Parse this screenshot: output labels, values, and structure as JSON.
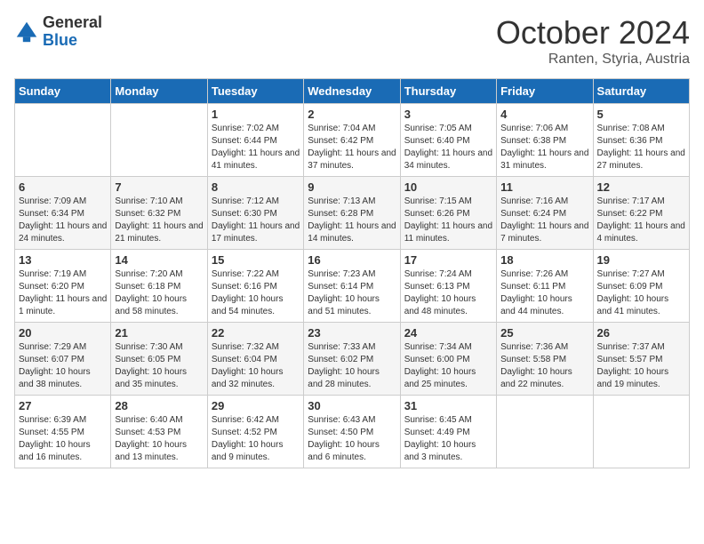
{
  "header": {
    "logo_general": "General",
    "logo_blue": "Blue",
    "month": "October 2024",
    "location": "Ranten, Styria, Austria"
  },
  "days_of_week": [
    "Sunday",
    "Monday",
    "Tuesday",
    "Wednesday",
    "Thursday",
    "Friday",
    "Saturday"
  ],
  "weeks": [
    [
      {
        "day": "",
        "content": ""
      },
      {
        "day": "",
        "content": ""
      },
      {
        "day": "1",
        "content": "Sunrise: 7:02 AM\nSunset: 6:44 PM\nDaylight: 11 hours and 41 minutes."
      },
      {
        "day": "2",
        "content": "Sunrise: 7:04 AM\nSunset: 6:42 PM\nDaylight: 11 hours and 37 minutes."
      },
      {
        "day": "3",
        "content": "Sunrise: 7:05 AM\nSunset: 6:40 PM\nDaylight: 11 hours and 34 minutes."
      },
      {
        "day": "4",
        "content": "Sunrise: 7:06 AM\nSunset: 6:38 PM\nDaylight: 11 hours and 31 minutes."
      },
      {
        "day": "5",
        "content": "Sunrise: 7:08 AM\nSunset: 6:36 PM\nDaylight: 11 hours and 27 minutes."
      }
    ],
    [
      {
        "day": "6",
        "content": "Sunrise: 7:09 AM\nSunset: 6:34 PM\nDaylight: 11 hours and 24 minutes."
      },
      {
        "day": "7",
        "content": "Sunrise: 7:10 AM\nSunset: 6:32 PM\nDaylight: 11 hours and 21 minutes."
      },
      {
        "day": "8",
        "content": "Sunrise: 7:12 AM\nSunset: 6:30 PM\nDaylight: 11 hours and 17 minutes."
      },
      {
        "day": "9",
        "content": "Sunrise: 7:13 AM\nSunset: 6:28 PM\nDaylight: 11 hours and 14 minutes."
      },
      {
        "day": "10",
        "content": "Sunrise: 7:15 AM\nSunset: 6:26 PM\nDaylight: 11 hours and 11 minutes."
      },
      {
        "day": "11",
        "content": "Sunrise: 7:16 AM\nSunset: 6:24 PM\nDaylight: 11 hours and 7 minutes."
      },
      {
        "day": "12",
        "content": "Sunrise: 7:17 AM\nSunset: 6:22 PM\nDaylight: 11 hours and 4 minutes."
      }
    ],
    [
      {
        "day": "13",
        "content": "Sunrise: 7:19 AM\nSunset: 6:20 PM\nDaylight: 11 hours and 1 minute."
      },
      {
        "day": "14",
        "content": "Sunrise: 7:20 AM\nSunset: 6:18 PM\nDaylight: 10 hours and 58 minutes."
      },
      {
        "day": "15",
        "content": "Sunrise: 7:22 AM\nSunset: 6:16 PM\nDaylight: 10 hours and 54 minutes."
      },
      {
        "day": "16",
        "content": "Sunrise: 7:23 AM\nSunset: 6:14 PM\nDaylight: 10 hours and 51 minutes."
      },
      {
        "day": "17",
        "content": "Sunrise: 7:24 AM\nSunset: 6:13 PM\nDaylight: 10 hours and 48 minutes."
      },
      {
        "day": "18",
        "content": "Sunrise: 7:26 AM\nSunset: 6:11 PM\nDaylight: 10 hours and 44 minutes."
      },
      {
        "day": "19",
        "content": "Sunrise: 7:27 AM\nSunset: 6:09 PM\nDaylight: 10 hours and 41 minutes."
      }
    ],
    [
      {
        "day": "20",
        "content": "Sunrise: 7:29 AM\nSunset: 6:07 PM\nDaylight: 10 hours and 38 minutes."
      },
      {
        "day": "21",
        "content": "Sunrise: 7:30 AM\nSunset: 6:05 PM\nDaylight: 10 hours and 35 minutes."
      },
      {
        "day": "22",
        "content": "Sunrise: 7:32 AM\nSunset: 6:04 PM\nDaylight: 10 hours and 32 minutes."
      },
      {
        "day": "23",
        "content": "Sunrise: 7:33 AM\nSunset: 6:02 PM\nDaylight: 10 hours and 28 minutes."
      },
      {
        "day": "24",
        "content": "Sunrise: 7:34 AM\nSunset: 6:00 PM\nDaylight: 10 hours and 25 minutes."
      },
      {
        "day": "25",
        "content": "Sunrise: 7:36 AM\nSunset: 5:58 PM\nDaylight: 10 hours and 22 minutes."
      },
      {
        "day": "26",
        "content": "Sunrise: 7:37 AM\nSunset: 5:57 PM\nDaylight: 10 hours and 19 minutes."
      }
    ],
    [
      {
        "day": "27",
        "content": "Sunrise: 6:39 AM\nSunset: 4:55 PM\nDaylight: 10 hours and 16 minutes."
      },
      {
        "day": "28",
        "content": "Sunrise: 6:40 AM\nSunset: 4:53 PM\nDaylight: 10 hours and 13 minutes."
      },
      {
        "day": "29",
        "content": "Sunrise: 6:42 AM\nSunset: 4:52 PM\nDaylight: 10 hours and 9 minutes."
      },
      {
        "day": "30",
        "content": "Sunrise: 6:43 AM\nSunset: 4:50 PM\nDaylight: 10 hours and 6 minutes."
      },
      {
        "day": "31",
        "content": "Sunrise: 6:45 AM\nSunset: 4:49 PM\nDaylight: 10 hours and 3 minutes."
      },
      {
        "day": "",
        "content": ""
      },
      {
        "day": "",
        "content": ""
      }
    ]
  ]
}
